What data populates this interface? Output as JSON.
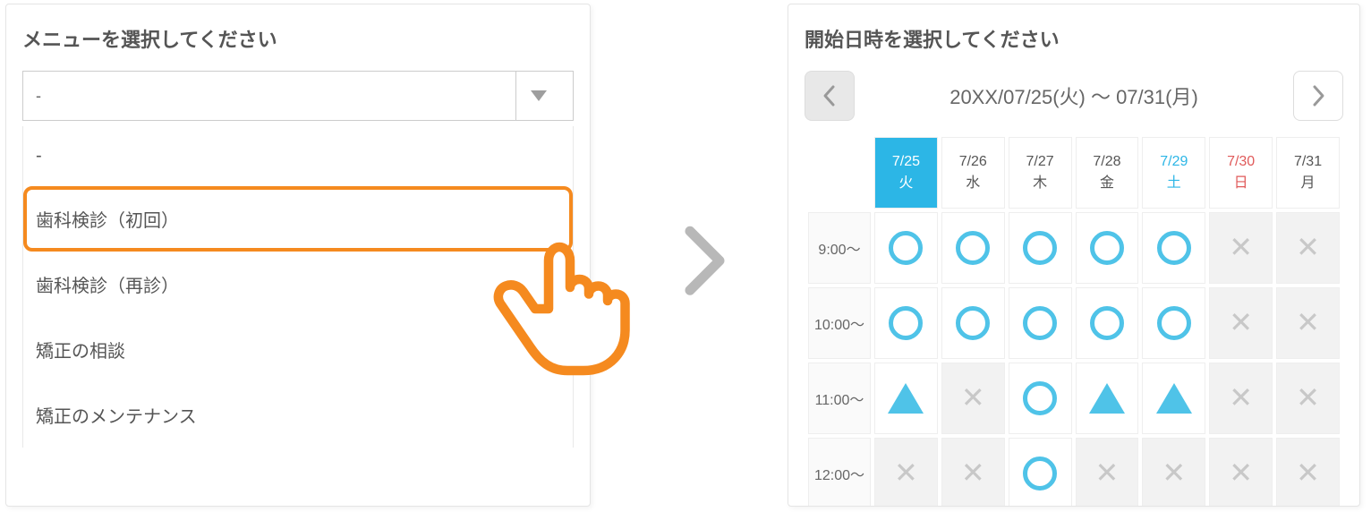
{
  "left": {
    "title": "メニューを選択してください",
    "select_value": "-",
    "options": [
      "-",
      "歯科検診（初回）",
      "歯科検診（再診）",
      "矯正の相談",
      "矯正のメンテナンス"
    ],
    "highlighted_index": 1
  },
  "right": {
    "title": "開始日時を選択してください",
    "date_range": "20XX/07/25(火) 〜 07/31(月)",
    "days": [
      {
        "date": "7/25",
        "dow": "火",
        "kind": "active"
      },
      {
        "date": "7/26",
        "dow": "水",
        "kind": ""
      },
      {
        "date": "7/27",
        "dow": "木",
        "kind": ""
      },
      {
        "date": "7/28",
        "dow": "金",
        "kind": ""
      },
      {
        "date": "7/29",
        "dow": "土",
        "kind": "sat"
      },
      {
        "date": "7/30",
        "dow": "日",
        "kind": "sun"
      },
      {
        "date": "7/31",
        "dow": "月",
        "kind": ""
      }
    ],
    "rows": [
      {
        "time": "9:00〜",
        "slots": [
          "O",
          "O",
          "O",
          "O",
          "O",
          "X",
          "X"
        ]
      },
      {
        "time": "10:00〜",
        "slots": [
          "O",
          "O",
          "O",
          "O",
          "O",
          "X",
          "X"
        ]
      },
      {
        "time": "11:00〜",
        "slots": [
          "T",
          "X",
          "O",
          "T",
          "T",
          "X",
          "X"
        ]
      },
      {
        "time": "12:00〜",
        "slots": [
          "X",
          "X",
          "O",
          "X",
          "X",
          "X",
          "X"
        ]
      }
    ]
  }
}
